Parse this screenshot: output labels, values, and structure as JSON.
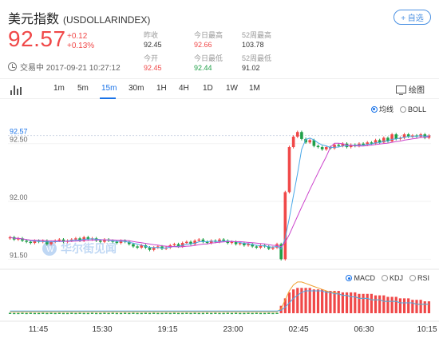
{
  "header": {
    "name": "美元指数",
    "code": "(USDOLLARINDEX)",
    "add_label": "+ 自选",
    "price": "92.57",
    "change": "+0.12",
    "change_pct": "+0.13%",
    "status_time": "交易中 2017-09-21 10:27:12"
  },
  "stats": [
    {
      "label": "昨收",
      "value": "92.45",
      "color": "#333333"
    },
    {
      "label": "今日最高",
      "value": "92.66",
      "color": "#f04848"
    },
    {
      "label": "52周最高",
      "value": "103.78",
      "color": "#333333"
    },
    {
      "label": "今开",
      "value": "92.45",
      "color": "#f04848"
    },
    {
      "label": "今日最低",
      "value": "92.44",
      "color": "#20a048"
    },
    {
      "label": "52周最低",
      "value": "91.02",
      "color": "#333333"
    }
  ],
  "toolbar": {
    "tabs": [
      "1m",
      "5m",
      "15m",
      "30m",
      "1H",
      "4H",
      "1D",
      "1W",
      "1M"
    ],
    "active_tab": "15m",
    "draw_label": "绘图"
  },
  "indicators": {
    "main": [
      {
        "label": "均线",
        "selected": true
      },
      {
        "label": "BOLL",
        "selected": false
      }
    ],
    "sub": [
      {
        "label": "MACD",
        "selected": true
      },
      {
        "label": "KDJ",
        "selected": false
      },
      {
        "label": "RSI",
        "selected": false
      }
    ]
  },
  "watermark": "华尔街见闻",
  "colors": {
    "up": "#f04848",
    "down": "#20a048",
    "ma_fast": "#4aa8e8",
    "ma_slow": "#cc44cc",
    "accent": "#1a73e8"
  },
  "chart_data": {
    "type": "candlestick",
    "ylim": [
      91.44,
      92.74
    ],
    "y_ticks": [
      "92.57",
      "92.50",
      "92.00",
      "91.50"
    ],
    "x_ticks": [
      "11:45",
      "15:30",
      "19:15",
      "23:00",
      "02:45",
      "06:30",
      "10:15"
    ],
    "last_price": 92.57,
    "close": [
      91.69,
      91.67,
      91.68,
      91.66,
      91.65,
      91.64,
      91.66,
      91.65,
      91.66,
      91.63,
      91.65,
      91.66,
      91.67,
      91.65,
      91.66,
      91.67,
      91.68,
      91.66,
      91.69,
      91.67,
      91.68,
      91.66,
      91.65,
      91.67,
      91.66,
      91.65,
      91.64,
      91.66,
      91.65,
      91.63,
      91.61,
      91.6,
      91.62,
      91.6,
      91.58,
      91.6,
      91.61,
      91.59,
      91.6,
      91.62,
      91.63,
      91.61,
      91.64,
      91.65,
      91.63,
      91.66,
      91.67,
      91.65,
      91.64,
      91.66,
      91.65,
      91.67,
      91.66,
      91.64,
      91.65,
      91.63,
      91.64,
      91.62,
      91.63,
      91.61,
      91.6,
      91.62,
      91.61,
      91.59,
      91.6,
      91.63,
      91.5,
      92.08,
      92.47,
      92.56,
      92.6,
      92.54,
      92.51,
      92.53,
      92.48,
      92.47,
      92.45,
      92.47,
      92.46,
      92.49,
      92.48,
      92.5,
      92.47,
      92.49,
      92.48,
      92.5,
      92.49,
      92.51,
      92.5,
      92.53,
      92.51,
      92.55,
      92.52,
      92.58,
      92.54,
      92.55,
      92.58,
      92.56,
      92.57,
      92.56,
      92.58,
      92.55,
      92.57
    ],
    "macd": {
      "hist": [
        0.003,
        0.002,
        0.002,
        0.003,
        0.002,
        0.003,
        0.002,
        0.002,
        0.003,
        0.002,
        0.003,
        0.002,
        0.003,
        0.002,
        0.002,
        0.003,
        0.002,
        0.003,
        0.002,
        0.002,
        0.003,
        0.002,
        0.002,
        0.003,
        0.002,
        0.003,
        0.002,
        0.002,
        0.003,
        0.002,
        0.003,
        0.002,
        0.002,
        0.003,
        0.002,
        0.003,
        0.002,
        0.002,
        0.003,
        0.002,
        0.003,
        0.002,
        0.002,
        0.003,
        0.002,
        0.003,
        0.002,
        0.002,
        0.003,
        0.002,
        0.003,
        0.002,
        0.002,
        0.003,
        0.002,
        0.003,
        0.002,
        0.002,
        0.003,
        0.002,
        0.003,
        0.002,
        0.002,
        0.003,
        0.002,
        0.003,
        0.05,
        0.1,
        0.14,
        0.16,
        0.17,
        0.17,
        0.17,
        0.17,
        0.16,
        0.16,
        0.16,
        0.15,
        0.15,
        0.15,
        0.15,
        0.14,
        0.14,
        0.14,
        0.14,
        0.13,
        0.13,
        0.13,
        0.13,
        0.12,
        0.12,
        0.12,
        0.11,
        0.11,
        0.11,
        0.1,
        0.1,
        0.1,
        0.09,
        0.09,
        0.09,
        0.08,
        0.08
      ],
      "dif": [
        0.01,
        0.01,
        0.01,
        0.01,
        0.01,
        0.01,
        0.01,
        0.01,
        0.01,
        0.01,
        0.01,
        0.01,
        0.01,
        0.01,
        0.01,
        0.01,
        0.01,
        0.01,
        0.01,
        0.01,
        0.01,
        0.01,
        0.01,
        0.01,
        0.01,
        0.01,
        0.01,
        0.01,
        0.01,
        0.01,
        0.01,
        0.01,
        0.01,
        0.01,
        0.01,
        0.01,
        0.01,
        0.01,
        0.01,
        0.01,
        0.01,
        0.01,
        0.01,
        0.01,
        0.01,
        0.01,
        0.01,
        0.01,
        0.01,
        0.01,
        0.01,
        0.01,
        0.01,
        0.01,
        0.01,
        0.01,
        0.01,
        0.01,
        0.01,
        0.01,
        0.01,
        0.01,
        0.01,
        0.01,
        0.01,
        0.01,
        0.03,
        0.09,
        0.15,
        0.19,
        0.21,
        0.21,
        0.2,
        0.19,
        0.18,
        0.17,
        0.16,
        0.15,
        0.14,
        0.14,
        0.13,
        0.12,
        0.12,
        0.11,
        0.11,
        0.1,
        0.1,
        0.1,
        0.09,
        0.09,
        0.09,
        0.08,
        0.08,
        0.08,
        0.08,
        0.07,
        0.07,
        0.07,
        0.07,
        0.06,
        0.06,
        0.06,
        0.06
      ],
      "dea": [
        0.015,
        0.015,
        0.015,
        0.015,
        0.015,
        0.015,
        0.015,
        0.015,
        0.015,
        0.015,
        0.015,
        0.015,
        0.015,
        0.015,
        0.015,
        0.015,
        0.015,
        0.015,
        0.015,
        0.015,
        0.015,
        0.015,
        0.015,
        0.015,
        0.015,
        0.015,
        0.015,
        0.015,
        0.015,
        0.015,
        0.015,
        0.015,
        0.015,
        0.015,
        0.015,
        0.015,
        0.015,
        0.015,
        0.015,
        0.015,
        0.015,
        0.015,
        0.015,
        0.015,
        0.015,
        0.015,
        0.015,
        0.015,
        0.015,
        0.015,
        0.015,
        0.015,
        0.015,
        0.015,
        0.015,
        0.015,
        0.015,
        0.015,
        0.015,
        0.015,
        0.015,
        0.015,
        0.015,
        0.015,
        0.015,
        0.015,
        0.02,
        0.04,
        0.07,
        0.1,
        0.12,
        0.14,
        0.15,
        0.15,
        0.15,
        0.15,
        0.15,
        0.14,
        0.14,
        0.13,
        0.13,
        0.12,
        0.12,
        0.11,
        0.11,
        0.1,
        0.1,
        0.1,
        0.09,
        0.09,
        0.09,
        0.08,
        0.08,
        0.08,
        0.08,
        0.07,
        0.07,
        0.07,
        0.07,
        0.06,
        0.06,
        0.06,
        0.06
      ]
    }
  }
}
